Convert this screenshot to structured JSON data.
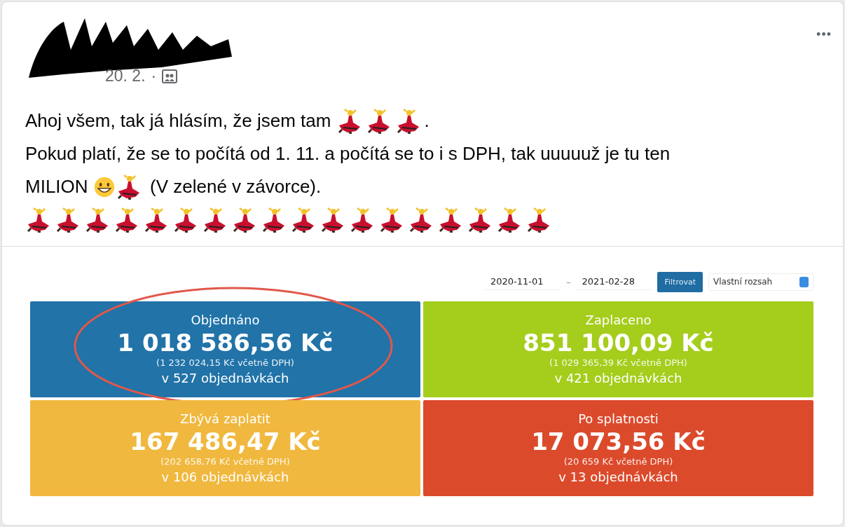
{
  "post": {
    "date": "20. 2.",
    "separator": "·",
    "more": "•••",
    "lines": [
      [
        {
          "kind": "text",
          "text": "Ahoj všem, tak já hlásím, že jsem tam "
        },
        {
          "kind": "dancer"
        },
        {
          "kind": "dancer"
        },
        {
          "kind": "dancer"
        },
        {
          "kind": "text",
          "text": "."
        }
      ],
      [
        {
          "kind": "text",
          "text": "Pokud platí, že se to počítá od 1. 11. a počítá se to i s DPH, tak uuuuuž je tu ten"
        }
      ],
      [
        {
          "kind": "text",
          "text": "MILION "
        },
        {
          "kind": "grin"
        },
        {
          "kind": "dancer"
        },
        {
          "kind": "text",
          "text": " (V zelené v závorce)."
        }
      ],
      [
        {
          "kind": "dancer"
        },
        {
          "kind": "dancer"
        },
        {
          "kind": "dancer"
        },
        {
          "kind": "dancer"
        },
        {
          "kind": "dancer"
        },
        {
          "kind": "dancer"
        },
        {
          "kind": "dancer"
        },
        {
          "kind": "dancer"
        },
        {
          "kind": "dancer"
        },
        {
          "kind": "dancer"
        },
        {
          "kind": "dancer"
        },
        {
          "kind": "dancer"
        },
        {
          "kind": "dancer"
        },
        {
          "kind": "dancer"
        },
        {
          "kind": "dancer"
        },
        {
          "kind": "dancer"
        },
        {
          "kind": "dancer"
        },
        {
          "kind": "dancer"
        }
      ]
    ]
  },
  "dashboard": {
    "date_from": "2020-11-01",
    "dash": "–",
    "date_to": "2021-02-28",
    "filter_button": "Filtrovat",
    "range": "Vlastní rozsah",
    "tiles": [
      {
        "title": "Objednáno",
        "amount": "1 018 586,56 Kč",
        "vat": "(1 232 024,15 Kč včetně DPH)",
        "orders": "v 527 objednávkách",
        "color": "#2173a8",
        "circled": true
      },
      {
        "title": "Zaplaceno",
        "amount": "851 100,09 Kč",
        "vat": "(1 029 365,39 Kč včetně DPH)",
        "orders": "v 421 objednávkách",
        "color": "#a5cd1c",
        "circled": false
      },
      {
        "title": "Zbývá zaplatit",
        "amount": "167 486,47 Kč",
        "vat": "(202 658,76 Kč včetně DPH)",
        "orders": "v 106 objednávkách",
        "color": "#f0b83e",
        "circled": false
      },
      {
        "title": "Po splatnosti",
        "amount": "17 073,56 Kč",
        "vat": "(20 659 Kč včetně DPH)",
        "orders": "v 13 objednávkách",
        "color": "#dc4a2c",
        "circled": false
      }
    ]
  }
}
